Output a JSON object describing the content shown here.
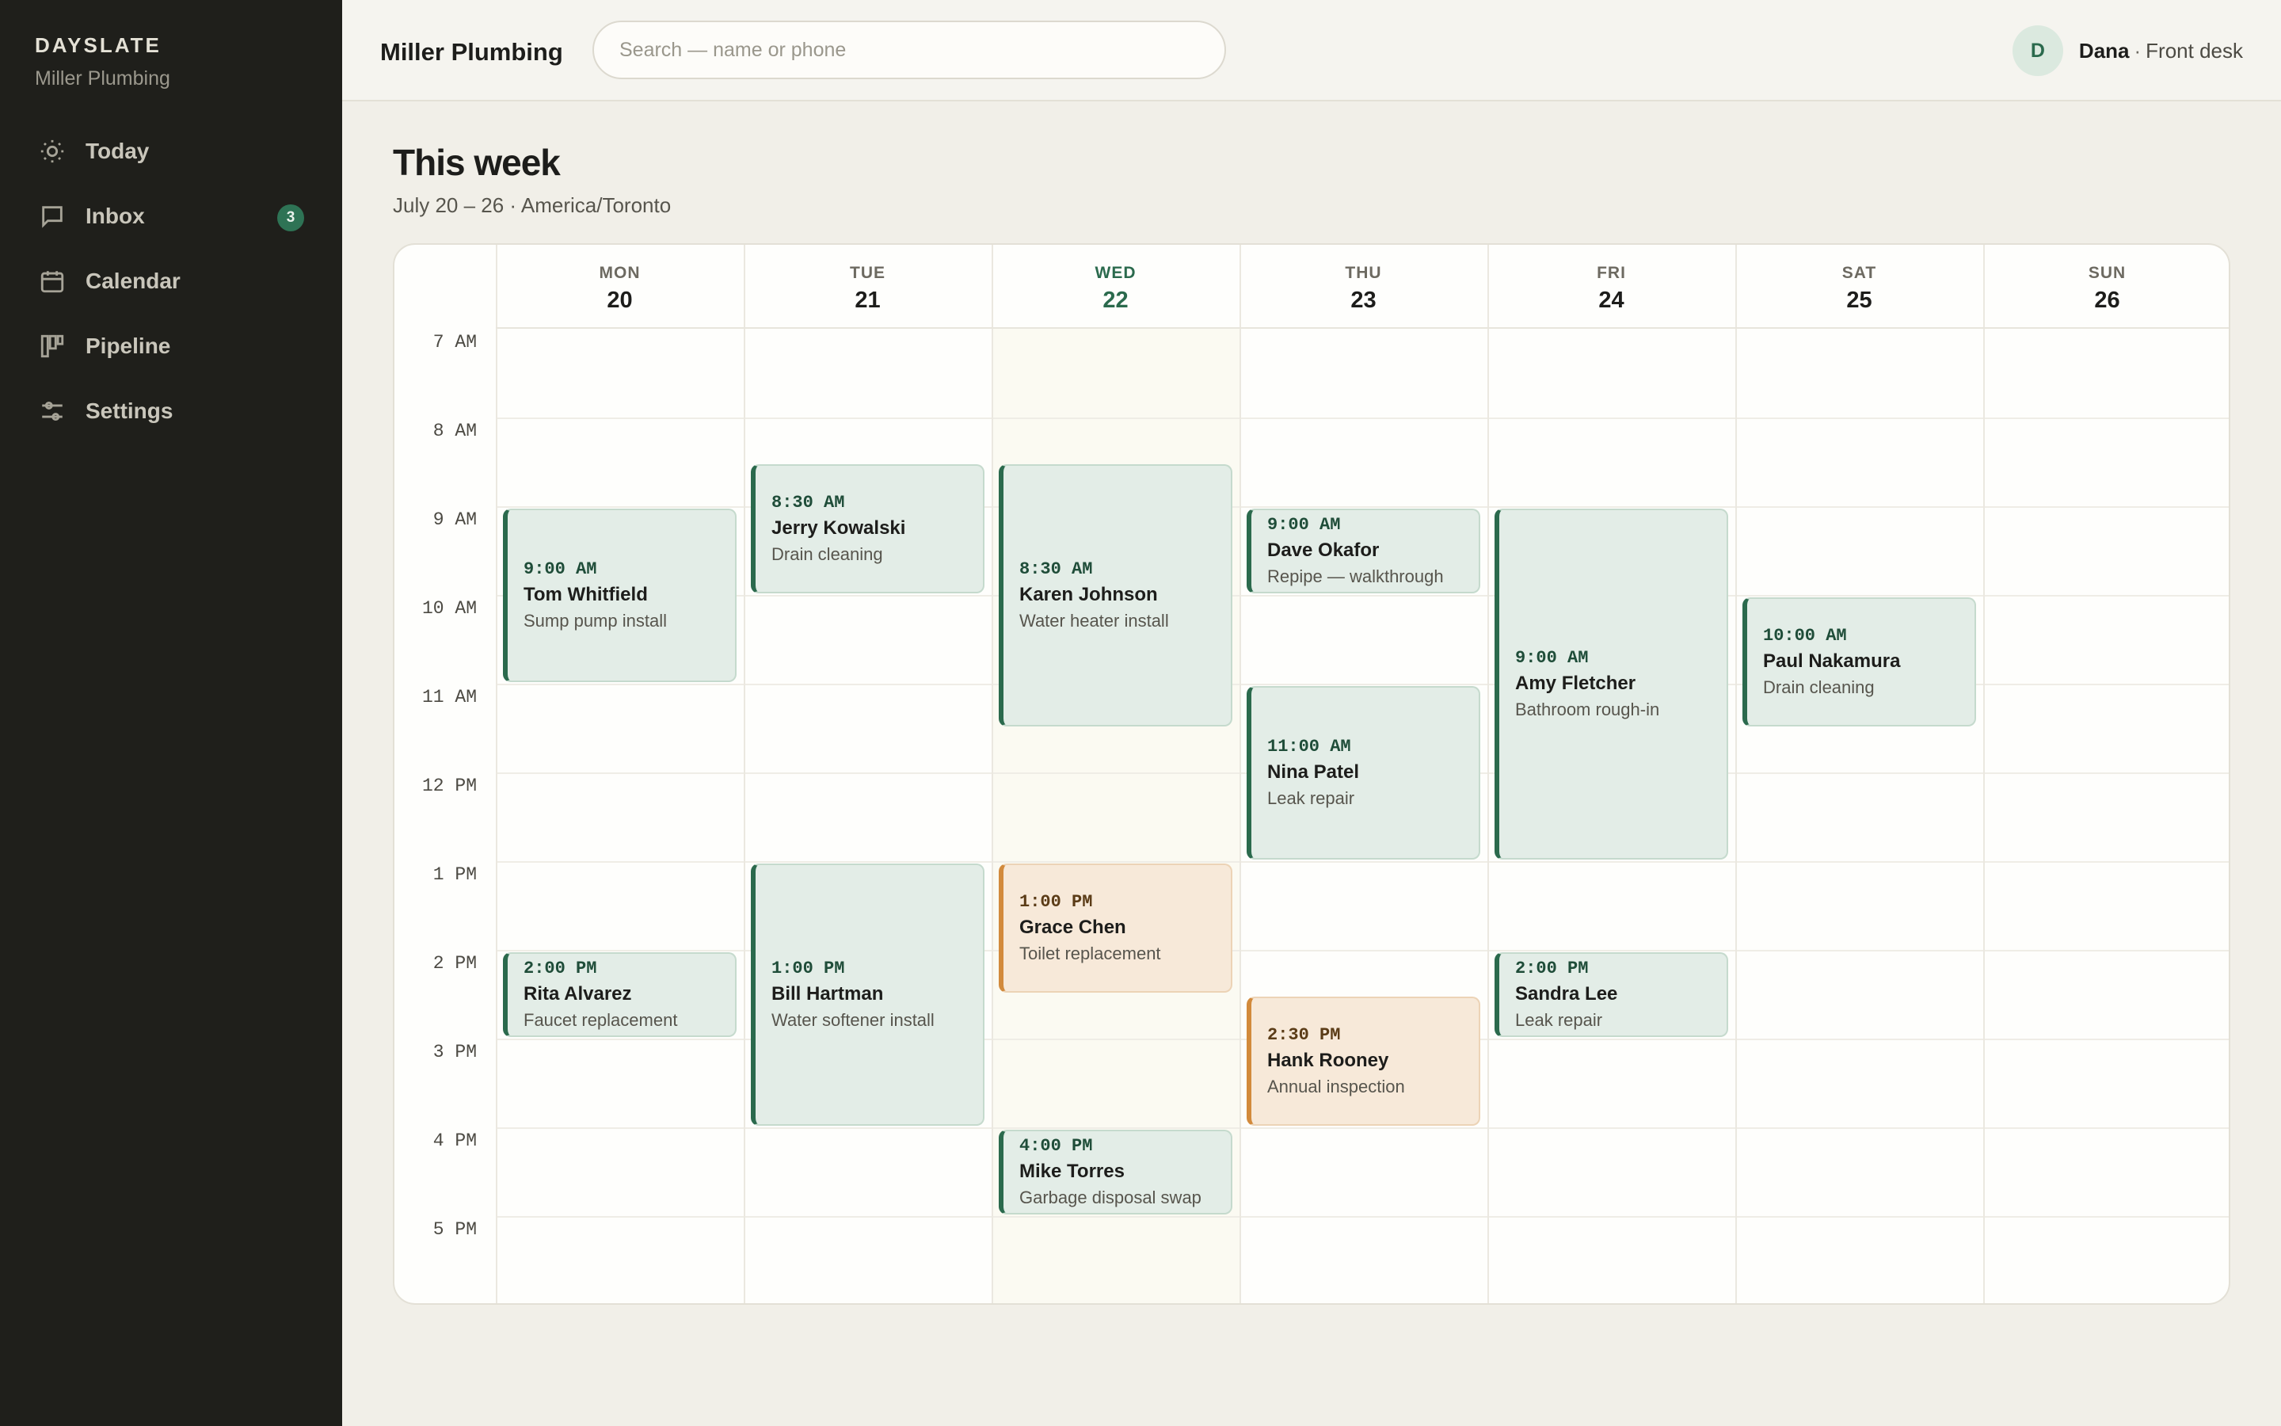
{
  "sidebar": {
    "brand": "DAYSLATE",
    "org": "Miller Plumbing",
    "items": [
      {
        "label": "Today",
        "icon": "sun-icon"
      },
      {
        "label": "Inbox",
        "icon": "message-icon",
        "badge": "3"
      },
      {
        "label": "Calendar",
        "icon": "calendar-icon"
      },
      {
        "label": "Pipeline",
        "icon": "kanban-icon"
      },
      {
        "label": "Settings",
        "icon": "sliders-icon"
      }
    ]
  },
  "topbar": {
    "company": "Miller Plumbing",
    "search_placeholder": "Search — name or phone",
    "search_value": "",
    "user_initial": "D",
    "user_name": "Dana",
    "user_separator": "·",
    "user_role": "Front desk"
  },
  "page": {
    "title": "This week",
    "subtitle": "July 20 – 26 · America/Toronto"
  },
  "calendar": {
    "today_index": 2,
    "days": [
      {
        "dow": "MON",
        "date": "20"
      },
      {
        "dow": "TUE",
        "date": "21"
      },
      {
        "dow": "WED",
        "date": "22"
      },
      {
        "dow": "THU",
        "date": "23"
      },
      {
        "dow": "FRI",
        "date": "24"
      },
      {
        "dow": "SAT",
        "date": "25"
      },
      {
        "dow": "SUN",
        "date": "26"
      }
    ],
    "hours": [
      "7 AM",
      "8 AM",
      "9 AM",
      "10 AM",
      "11 AM",
      "12 PM",
      "1 PM",
      "2 PM",
      "3 PM",
      "4 PM",
      "5 PM"
    ],
    "appointments": [
      {
        "day": 0,
        "start": 9.0,
        "end": 11.0,
        "time": "9:00 AM",
        "name": "Tom Whitfield",
        "desc": "Sump pump install",
        "tone": "green"
      },
      {
        "day": 0,
        "start": 14.0,
        "end": 15.0,
        "time": "2:00 PM",
        "name": "Rita Alvarez",
        "desc": "Faucet replacement",
        "tone": "green"
      },
      {
        "day": 1,
        "start": 8.5,
        "end": 10.0,
        "time": "8:30 AM",
        "name": "Jerry Kowalski",
        "desc": "Drain cleaning",
        "tone": "green"
      },
      {
        "day": 1,
        "start": 13.0,
        "end": 16.0,
        "time": "1:00 PM",
        "name": "Bill Hartman",
        "desc": "Water softener install",
        "tone": "green"
      },
      {
        "day": 2,
        "start": 8.5,
        "end": 11.5,
        "time": "8:30 AM",
        "name": "Karen Johnson",
        "desc": "Water heater install",
        "tone": "green"
      },
      {
        "day": 2,
        "start": 13.0,
        "end": 14.5,
        "time": "1:00 PM",
        "name": "Grace Chen",
        "desc": "Toilet replacement",
        "tone": "amber"
      },
      {
        "day": 2,
        "start": 16.0,
        "end": 17.0,
        "time": "4:00 PM",
        "name": "Mike Torres",
        "desc": "Garbage disposal swap",
        "tone": "green"
      },
      {
        "day": 3,
        "start": 9.0,
        "end": 10.0,
        "time": "9:00 AM",
        "name": "Dave Okafor",
        "desc": "Repipe — walkthrough",
        "tone": "green"
      },
      {
        "day": 3,
        "start": 11.0,
        "end": 13.0,
        "time": "11:00 AM",
        "name": "Nina Patel",
        "desc": "Leak repair",
        "tone": "green"
      },
      {
        "day": 3,
        "start": 14.5,
        "end": 16.0,
        "time": "2:30 PM",
        "name": "Hank Rooney",
        "desc": "Annual inspection",
        "tone": "amber"
      },
      {
        "day": 4,
        "start": 9.0,
        "end": 13.0,
        "time": "9:00 AM",
        "name": "Amy Fletcher",
        "desc": "Bathroom rough-in",
        "tone": "green"
      },
      {
        "day": 4,
        "start": 14.0,
        "end": 15.0,
        "time": "2:00 PM",
        "name": "Sandra Lee",
        "desc": "Leak repair",
        "tone": "green"
      },
      {
        "day": 5,
        "start": 10.0,
        "end": 11.5,
        "time": "10:00 AM",
        "name": "Paul Nakamura",
        "desc": "Drain cleaning",
        "tone": "green"
      }
    ]
  },
  "colors": {
    "sidebar_bg": "#1f1f1b",
    "accent_green": "#2b6a4d",
    "appt_green_bg": "#e3ede7",
    "accent_amber": "#d28a3c",
    "appt_amber_bg": "#f7e9d9"
  }
}
